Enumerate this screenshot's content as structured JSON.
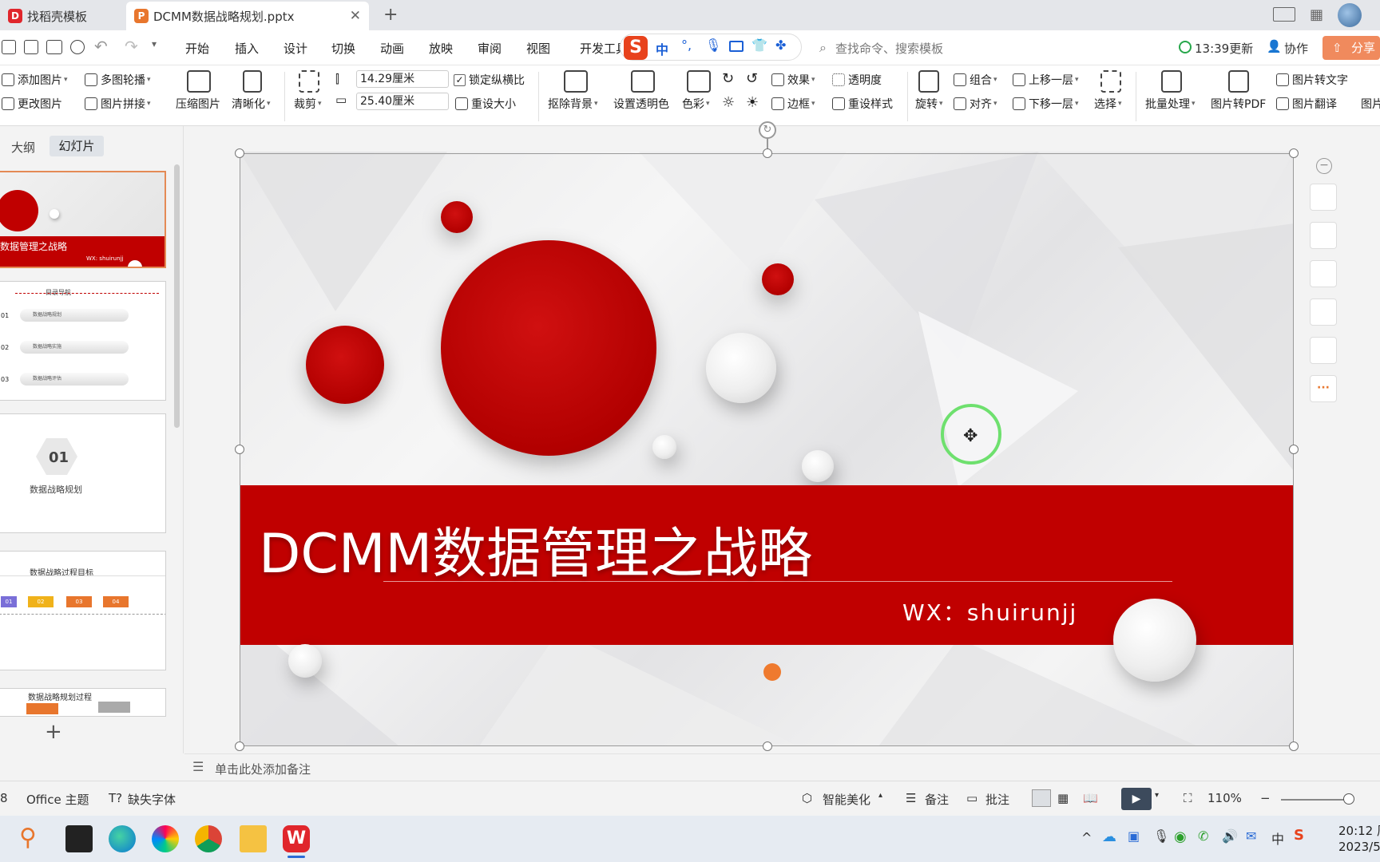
{
  "tabs": [
    {
      "label": "找稻壳模板"
    },
    {
      "label": "DCMM数据战略规划.pptx"
    }
  ],
  "menu": [
    "开始",
    "插入",
    "设计",
    "切换",
    "动画",
    "放映",
    "审阅",
    "视图",
    "开发工具"
  ],
  "search_placeholder": "查找命令、搜索模板",
  "update_time": "13:39更新",
  "collab": "协作",
  "share": "分享",
  "ribbon": {
    "add_pic": "添加图片",
    "multi_carousel": "多图轮播",
    "change_pic": "更改图片",
    "pic_collage": "图片拼接",
    "compress": "压缩图片",
    "sharpen": "清晰化",
    "crop": "裁剪",
    "height": "14.29厘米",
    "width": "25.40厘米",
    "lock_ratio": "锁定纵横比",
    "reset_size": "重设大小",
    "remove_bg": "抠除背景",
    "set_transparent": "设置透明色",
    "color": "色彩",
    "effect": "效果",
    "transparency": "透明度",
    "border": "边框",
    "reset_style": "重设样式",
    "rotate": "旋转",
    "group": "组合",
    "align": "对齐",
    "bring_forward": "上移一层",
    "send_backward": "下移一层",
    "select": "选择",
    "batch": "批量处理",
    "to_pdf": "图片转PDF",
    "to_text": "图片转文字",
    "translate": "图片翻译",
    "more": "图片"
  },
  "left_tabs": {
    "outline": "大纲",
    "slides": "幻灯片"
  },
  "thumbs": {
    "t1_title": "数据管理之战略",
    "t1_sub": "WX: shuirunjj",
    "t2_title": "目录导航",
    "t2_items": [
      {
        "num": "01",
        "text": "数据战略规划"
      },
      {
        "num": "02",
        "text": "数据战略实施"
      },
      {
        "num": "03",
        "text": "数据战略评估"
      }
    ],
    "t3_num": "01",
    "t3_text": "数据战略规划",
    "t4_title": "数据战略过程目标",
    "t4_tags": [
      "01",
      "02",
      "03",
      "04"
    ],
    "t5_title": "数据战略规划过程"
  },
  "slide": {
    "title": "DCMM数据管理之战略",
    "subtitle": "WX：shuirunjj"
  },
  "notes_placeholder": "单击此处添加备注",
  "status": {
    "slide_num": "8",
    "theme": "Office 主题",
    "missing_font": "缺失字体",
    "beautify": "智能美化",
    "notes": "备注",
    "comment": "批注",
    "zoom": "110%"
  },
  "clock": {
    "time": "20:12 周",
    "date": "2023/5"
  },
  "colors": {
    "accent": "#c00000",
    "wps_red": "#e0262c"
  }
}
